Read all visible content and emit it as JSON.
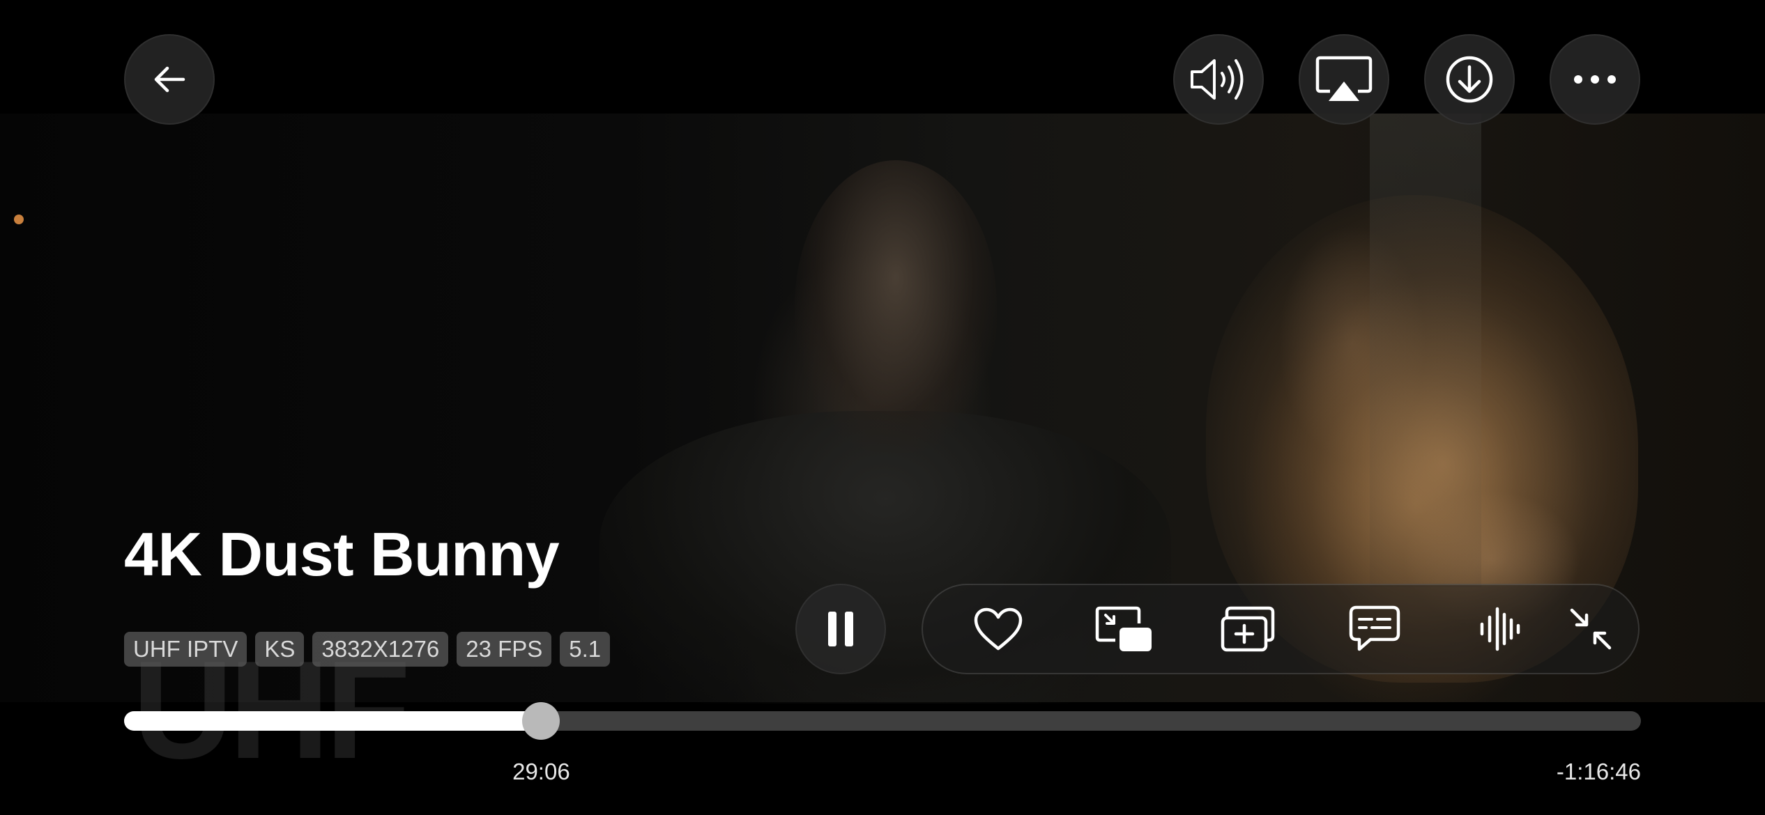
{
  "player": {
    "title": "4K Dust Bunny",
    "watermark": "UHF",
    "badges": [
      "UHF IPTV",
      "KS",
      "3832X1276",
      "23 FPS",
      "5.1"
    ],
    "elapsed": "29:06",
    "remaining": "-1:16:46",
    "progress_fraction": 0.275,
    "state": "playing"
  },
  "top_bar": {
    "left": [
      "back-arrow-icon"
    ],
    "right": [
      "speaker-volume-icon",
      "airplay-icon",
      "download-icon",
      "more-dots-icon"
    ]
  },
  "toolbar": {
    "items": [
      "heart-icon",
      "picture-in-picture-icon",
      "add-to-queue-icon",
      "subtitles-icon",
      "audio-waveform-icon",
      "exit-fullscreen-icon"
    ]
  },
  "colors": {
    "accent_dot": "#c9803d",
    "button_bg": "#262626",
    "progress_fill": "#ffffff",
    "progress_track": "#464646",
    "badge_bg": "#5a5a5a"
  }
}
